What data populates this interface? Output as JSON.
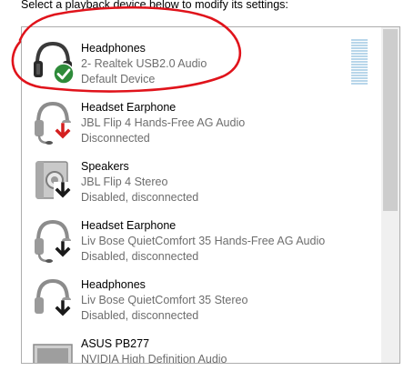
{
  "instruction_text": "Select a playback device below to modify its settings:",
  "devices": [
    {
      "name": "Headphones",
      "driver": "2- Realtek USB2.0 Audio",
      "status": "Default Device",
      "icon": "headphones-icon",
      "badge": "default-check-icon"
    },
    {
      "name": "Headset Earphone",
      "driver": "JBL Flip 4 Hands-Free AG Audio",
      "status": "Disconnected",
      "icon": "headset-icon",
      "badge": "disconnected-arrow-icon"
    },
    {
      "name": "Speakers",
      "driver": "JBL Flip 4 Stereo",
      "status": "Disabled, disconnected",
      "icon": "speaker-icon",
      "badge": "disabled-arrow-icon"
    },
    {
      "name": "Headset Earphone",
      "driver": "Liv Bose QuietComfort 35 Hands-Free AG Audio",
      "status": "Disabled, disconnected",
      "icon": "headset-icon",
      "badge": "disabled-arrow-icon"
    },
    {
      "name": "Headphones",
      "driver": "Liv Bose QuietComfort 35 Stereo",
      "status": "Disabled, disconnected",
      "icon": "headphones-icon",
      "badge": "disabled-arrow-icon"
    },
    {
      "name": "ASUS PB277",
      "driver": "NVIDIA High Definition Audio",
      "status": "",
      "icon": "monitor-icon",
      "badge": ""
    }
  ],
  "colors": {
    "annotation": "#e0131b",
    "default_badge": "#2e8b3a",
    "disconnected_badge": "#d42020",
    "disabled_badge": "#1a1a1a",
    "secondary_text": "#6d6d6d"
  }
}
